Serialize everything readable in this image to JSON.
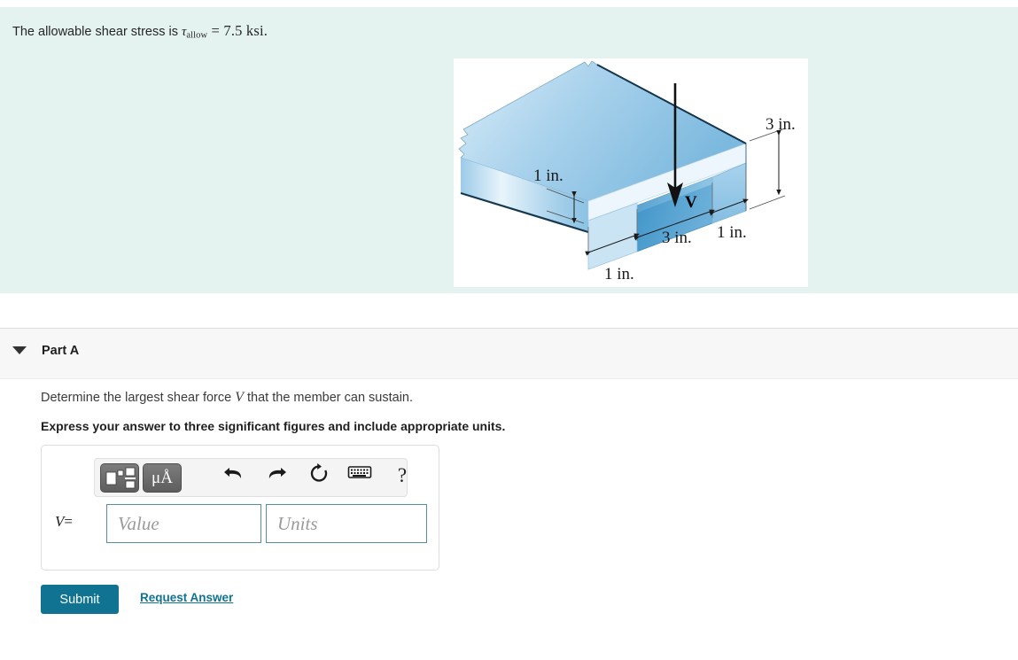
{
  "problem": {
    "prefix": "The allowable shear stress is ",
    "symbol": "τ",
    "subscript": "allow",
    "equals": "=",
    "value": "7.5 ksi."
  },
  "figure": {
    "caption": "T-shaped beam segment with downward shear force V",
    "labels": {
      "flange_thickness": "1 in.",
      "height": "3 in.",
      "web_left": "1 in.",
      "web_width": "3 in.",
      "web_right": "1 in.",
      "force": "V"
    },
    "colors": {
      "body_light": "#cfe6f5",
      "body_mid": "#8cc3e4",
      "body_dark": "#5ba4d0",
      "outline": "#1d3a52"
    }
  },
  "part_a": {
    "caret_label": "collapse",
    "title": "Part A",
    "question_prefix": "Determine the largest shear force ",
    "question_var": "V",
    "question_suffix": " that the member can sustain.",
    "instruction": "Express your answer to three significant figures and include appropriate units."
  },
  "answer": {
    "toolbar": {
      "template_label": "math template",
      "units_label": "μÅ",
      "undo_label": "undo",
      "redo_label": "redo",
      "reset_label": "reset",
      "keyboard_label": "keyboard",
      "help_label": "?"
    },
    "variable": "V",
    "equals": "=",
    "value_placeholder": "Value",
    "value_current": "",
    "units_placeholder": "Units",
    "units_current": ""
  },
  "actions": {
    "submit_label": "Submit",
    "request_answer_label": "Request Answer"
  },
  "theme": {
    "band_background": "#e4f3f0",
    "header_background": "#f7f7f7",
    "accent": "#0f7391",
    "input_border": "#57909c"
  }
}
